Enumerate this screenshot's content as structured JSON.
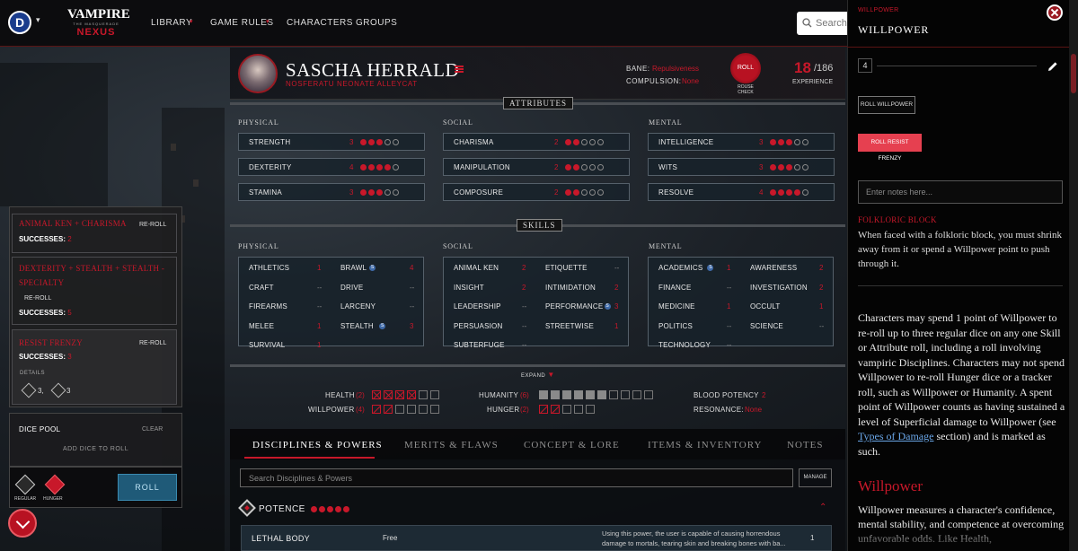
{
  "topbar": {
    "logo_letter": "D",
    "logo_caret": "▾",
    "brand_top": "VAMPIRE",
    "brand_sub": "THE MASQUERADE",
    "brand_bottom": "NEXUS",
    "nav": [
      "LIBRARY",
      "GAME RULES",
      "CHARACTERS",
      "GROUPS"
    ],
    "nav_caret": "▾",
    "search_placeholder": "Search"
  },
  "character": {
    "name": "SASCHA HERRALD",
    "subtitle": "NOSFERATU  NEONATE  ALLEYCAT",
    "bane_label": "BANE:",
    "bane_value": "Repulsiveness",
    "compulsion_label": "COMPULSION:",
    "compulsion_value": "None",
    "roll_label": "ROLL",
    "rouse_label": "ROUSE CHECK",
    "xp_current": "18",
    "xp_total": "/186",
    "xp_label": "EXPERIENCE"
  },
  "attributes": {
    "title": "ATTRIBUTES",
    "columns": [
      {
        "title": "PHYSICAL",
        "items": [
          {
            "name": "STRENGTH",
            "value": "3",
            "dots": 3
          },
          {
            "name": "DEXTERITY",
            "value": "4",
            "dots": 4
          },
          {
            "name": "STAMINA",
            "value": "3",
            "dots": 3
          }
        ]
      },
      {
        "title": "SOCIAL",
        "items": [
          {
            "name": "CHARISMA",
            "value": "2",
            "dots": 2
          },
          {
            "name": "MANIPULATION",
            "value": "2",
            "dots": 2
          },
          {
            "name": "COMPOSURE",
            "value": "2",
            "dots": 2
          }
        ]
      },
      {
        "title": "MENTAL",
        "items": [
          {
            "name": "INTELLIGENCE",
            "value": "3",
            "dots": 3
          },
          {
            "name": "WITS",
            "value": "3",
            "dots": 3
          },
          {
            "name": "RESOLVE",
            "value": "4",
            "dots": 4
          }
        ]
      }
    ]
  },
  "skills": {
    "title": "SKILLS",
    "columns": [
      {
        "title": "PHYSICAL",
        "left": [
          {
            "name": "ATHLETICS",
            "value": "1"
          },
          {
            "name": "CRAFT",
            "value": "--"
          },
          {
            "name": "FIREARMS",
            "value": "--"
          },
          {
            "name": "MELEE",
            "value": "1"
          },
          {
            "name": "SURVIVAL",
            "value": "1"
          }
        ],
        "right": [
          {
            "name": "BRAWL",
            "value": "4",
            "spec": "S"
          },
          {
            "name": "DRIVE",
            "value": "--"
          },
          {
            "name": "LARCENY",
            "value": "--"
          },
          {
            "name": "STEALTH",
            "value": "3",
            "spec": "S"
          }
        ]
      },
      {
        "title": "SOCIAL",
        "left": [
          {
            "name": "ANIMAL KEN",
            "value": "2"
          },
          {
            "name": "INSIGHT",
            "value": "2"
          },
          {
            "name": "LEADERSHIP",
            "value": "--"
          },
          {
            "name": "PERSUASION",
            "value": "--"
          },
          {
            "name": "SUBTERFUGE",
            "value": "--"
          }
        ],
        "right": [
          {
            "name": "ETIQUETTE",
            "value": "--"
          },
          {
            "name": "INTIMIDATION",
            "value": "2"
          },
          {
            "name": "PERFORMANCE",
            "value": "3",
            "spec": "S"
          },
          {
            "name": "STREETWISE",
            "value": "1"
          }
        ]
      },
      {
        "title": "MENTAL",
        "left": [
          {
            "name": "ACADEMICS",
            "value": "1",
            "spec": "S"
          },
          {
            "name": "FINANCE",
            "value": "--"
          },
          {
            "name": "MEDICINE",
            "value": "1"
          },
          {
            "name": "POLITICS",
            "value": "--"
          },
          {
            "name": "TECHNOLOGY",
            "value": "--"
          }
        ],
        "right": [
          {
            "name": "AWARENESS",
            "value": "2"
          },
          {
            "name": "INVESTIGATION",
            "value": "2"
          },
          {
            "name": "OCCULT",
            "value": "1"
          },
          {
            "name": "SCIENCE",
            "value": "--"
          }
        ]
      }
    ],
    "expand_label": "EXPAND"
  },
  "trackers": {
    "health_label": "HEALTH",
    "health_count": "(2)",
    "willpower_label": "WILLPOWER",
    "willpower_count": "(4)",
    "humanity_label": "HUMANITY",
    "humanity_count": "(6)",
    "hunger_label": "HUNGER",
    "hunger_count": "(2)",
    "blood_potency_label": "BLOOD POTENCY",
    "blood_potency_value": "2",
    "resonance_label": "RESONANCE:",
    "resonance_value": "None",
    "health_boxes": [
      "x",
      "x",
      "x",
      "x",
      "",
      ""
    ],
    "willpower_boxes": [
      "sl",
      "sl",
      "",
      "",
      "",
      ""
    ],
    "humanity_boxes": [
      "fill",
      "fill",
      "fill",
      "fill",
      "fill",
      "fill",
      "",
      "",
      "",
      ""
    ],
    "hunger_boxes": [
      "sl",
      "sl",
      "",
      "",
      ""
    ]
  },
  "tabs": [
    "DISCIPLINES & POWERS",
    "MERITS & FLAWS",
    "CONCEPT & LORE",
    "ITEMS & INVENTORY",
    "NOTES"
  ],
  "disciplines": {
    "search_placeholder": "Search Disciplines & Powers",
    "manage_label": "MANAGE",
    "discipline_name": "POTENCE",
    "discipline_dots": 5,
    "collapse_icon": "⌃",
    "power": {
      "name": "LETHAL BODY",
      "cost": "Free",
      "desc_line1": "Using this power, the user is capable of causing horrendous",
      "desc_line2": "damage to mortals, tearing skin and breaking bones with ba...",
      "level": "1"
    }
  },
  "roll_log": [
    {
      "title": "ANIMAL KEN + CHARISMA",
      "reroll": "RE-ROLL",
      "successes_label": "SUCCESSES:",
      "successes": "2"
    },
    {
      "title_line1": "DEXTERITY + STEALTH + STEALTH -",
      "title_line2": "SPECIALTY",
      "reroll": "RE-ROLL",
      "successes_label": "SUCCESSES:",
      "successes": "5"
    },
    {
      "title": "RESIST FRENZY",
      "reroll": "RE-ROLL",
      "successes_label": "SUCCESSES:",
      "successes": "3",
      "details_label": "DETAILS",
      "die1_count": "3,",
      "die2_count": "3"
    }
  ],
  "dice_pool": {
    "title": "DICE POOL",
    "clear_label": "CLEAR",
    "add_label": "ADD DICE TO ROLL",
    "regular_label": "REGULAR",
    "hunger_label": "HUNGER",
    "roll_label": "ROLL"
  },
  "sidebar": {
    "kicker": "WILLPOWER",
    "title": "WILLPOWER",
    "value": "4",
    "btn_roll": "ROLL WILLPOWER",
    "btn_frenzy": "ROLL RESIST FRENZY",
    "notes_placeholder": "Enter notes here...",
    "block_title": "FOLKLORIC BLOCK",
    "block_text": "When faced with a folkloric block, you must shrink away from it or spend a Willpower point to push through it.",
    "body_pre": "Characters may spend 1 point of Willpower to re-roll up to three regular dice on any one Skill or Attribute roll, including a roll involving vampiric Disciplines. Characters may not spend Willpower to re-roll Hunger dice or a tracker roll, such as Willpower or Humanity. A spent point of Willpower counts as having sustained a level of Superficial damage to Willpower (see ",
    "body_link": "Types of Damage",
    "body_post": " section) and is marked as such.",
    "heading2": "Willpower",
    "body3": "Willpower measures a character's confidence, mental stability, and competence at overcoming unfavorable odds. Like Health,"
  },
  "colors": {
    "accent": "#c8182a",
    "panel": "#18222a",
    "frenzy_button": "#e64050",
    "dice_roll_button": "#1f5a78"
  }
}
